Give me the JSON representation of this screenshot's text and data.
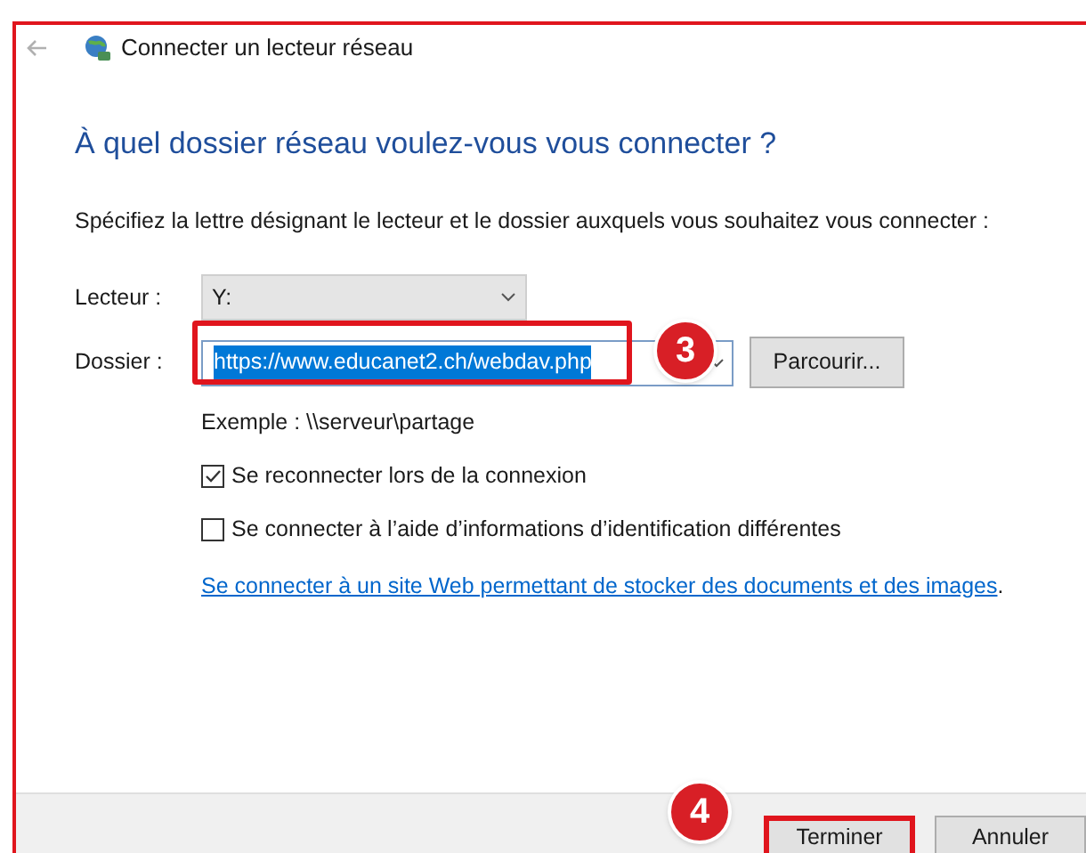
{
  "window": {
    "title": "Connecter un lecteur réseau"
  },
  "heading": "À quel dossier réseau voulez-vous vous connecter ?",
  "instruction": "Spécifiez la lettre désignant le lecteur et le dossier auxquels vous souhaitez vous connecter :",
  "drive": {
    "label": "Lecteur :",
    "value": "Y:"
  },
  "folder": {
    "label": "Dossier :",
    "value": "https://www.educanet2.ch/webdav.php",
    "selected": true,
    "annotation": "3"
  },
  "browse_button": "Parcourir...",
  "example": "Exemple : \\\\serveur\\partage",
  "options": [
    {
      "label": "Se reconnecter lors de la connexion",
      "checked": true
    },
    {
      "label": "Se connecter à l’aide d’informations d’identification différentes",
      "checked": false
    }
  ],
  "link": "Se connecter à un site Web permettant de stocker des documents et des images",
  "link_suffix": ".",
  "buttons": [
    {
      "label": "Terminer",
      "annotation": "4"
    },
    {
      "label": "Annuler"
    }
  ]
}
